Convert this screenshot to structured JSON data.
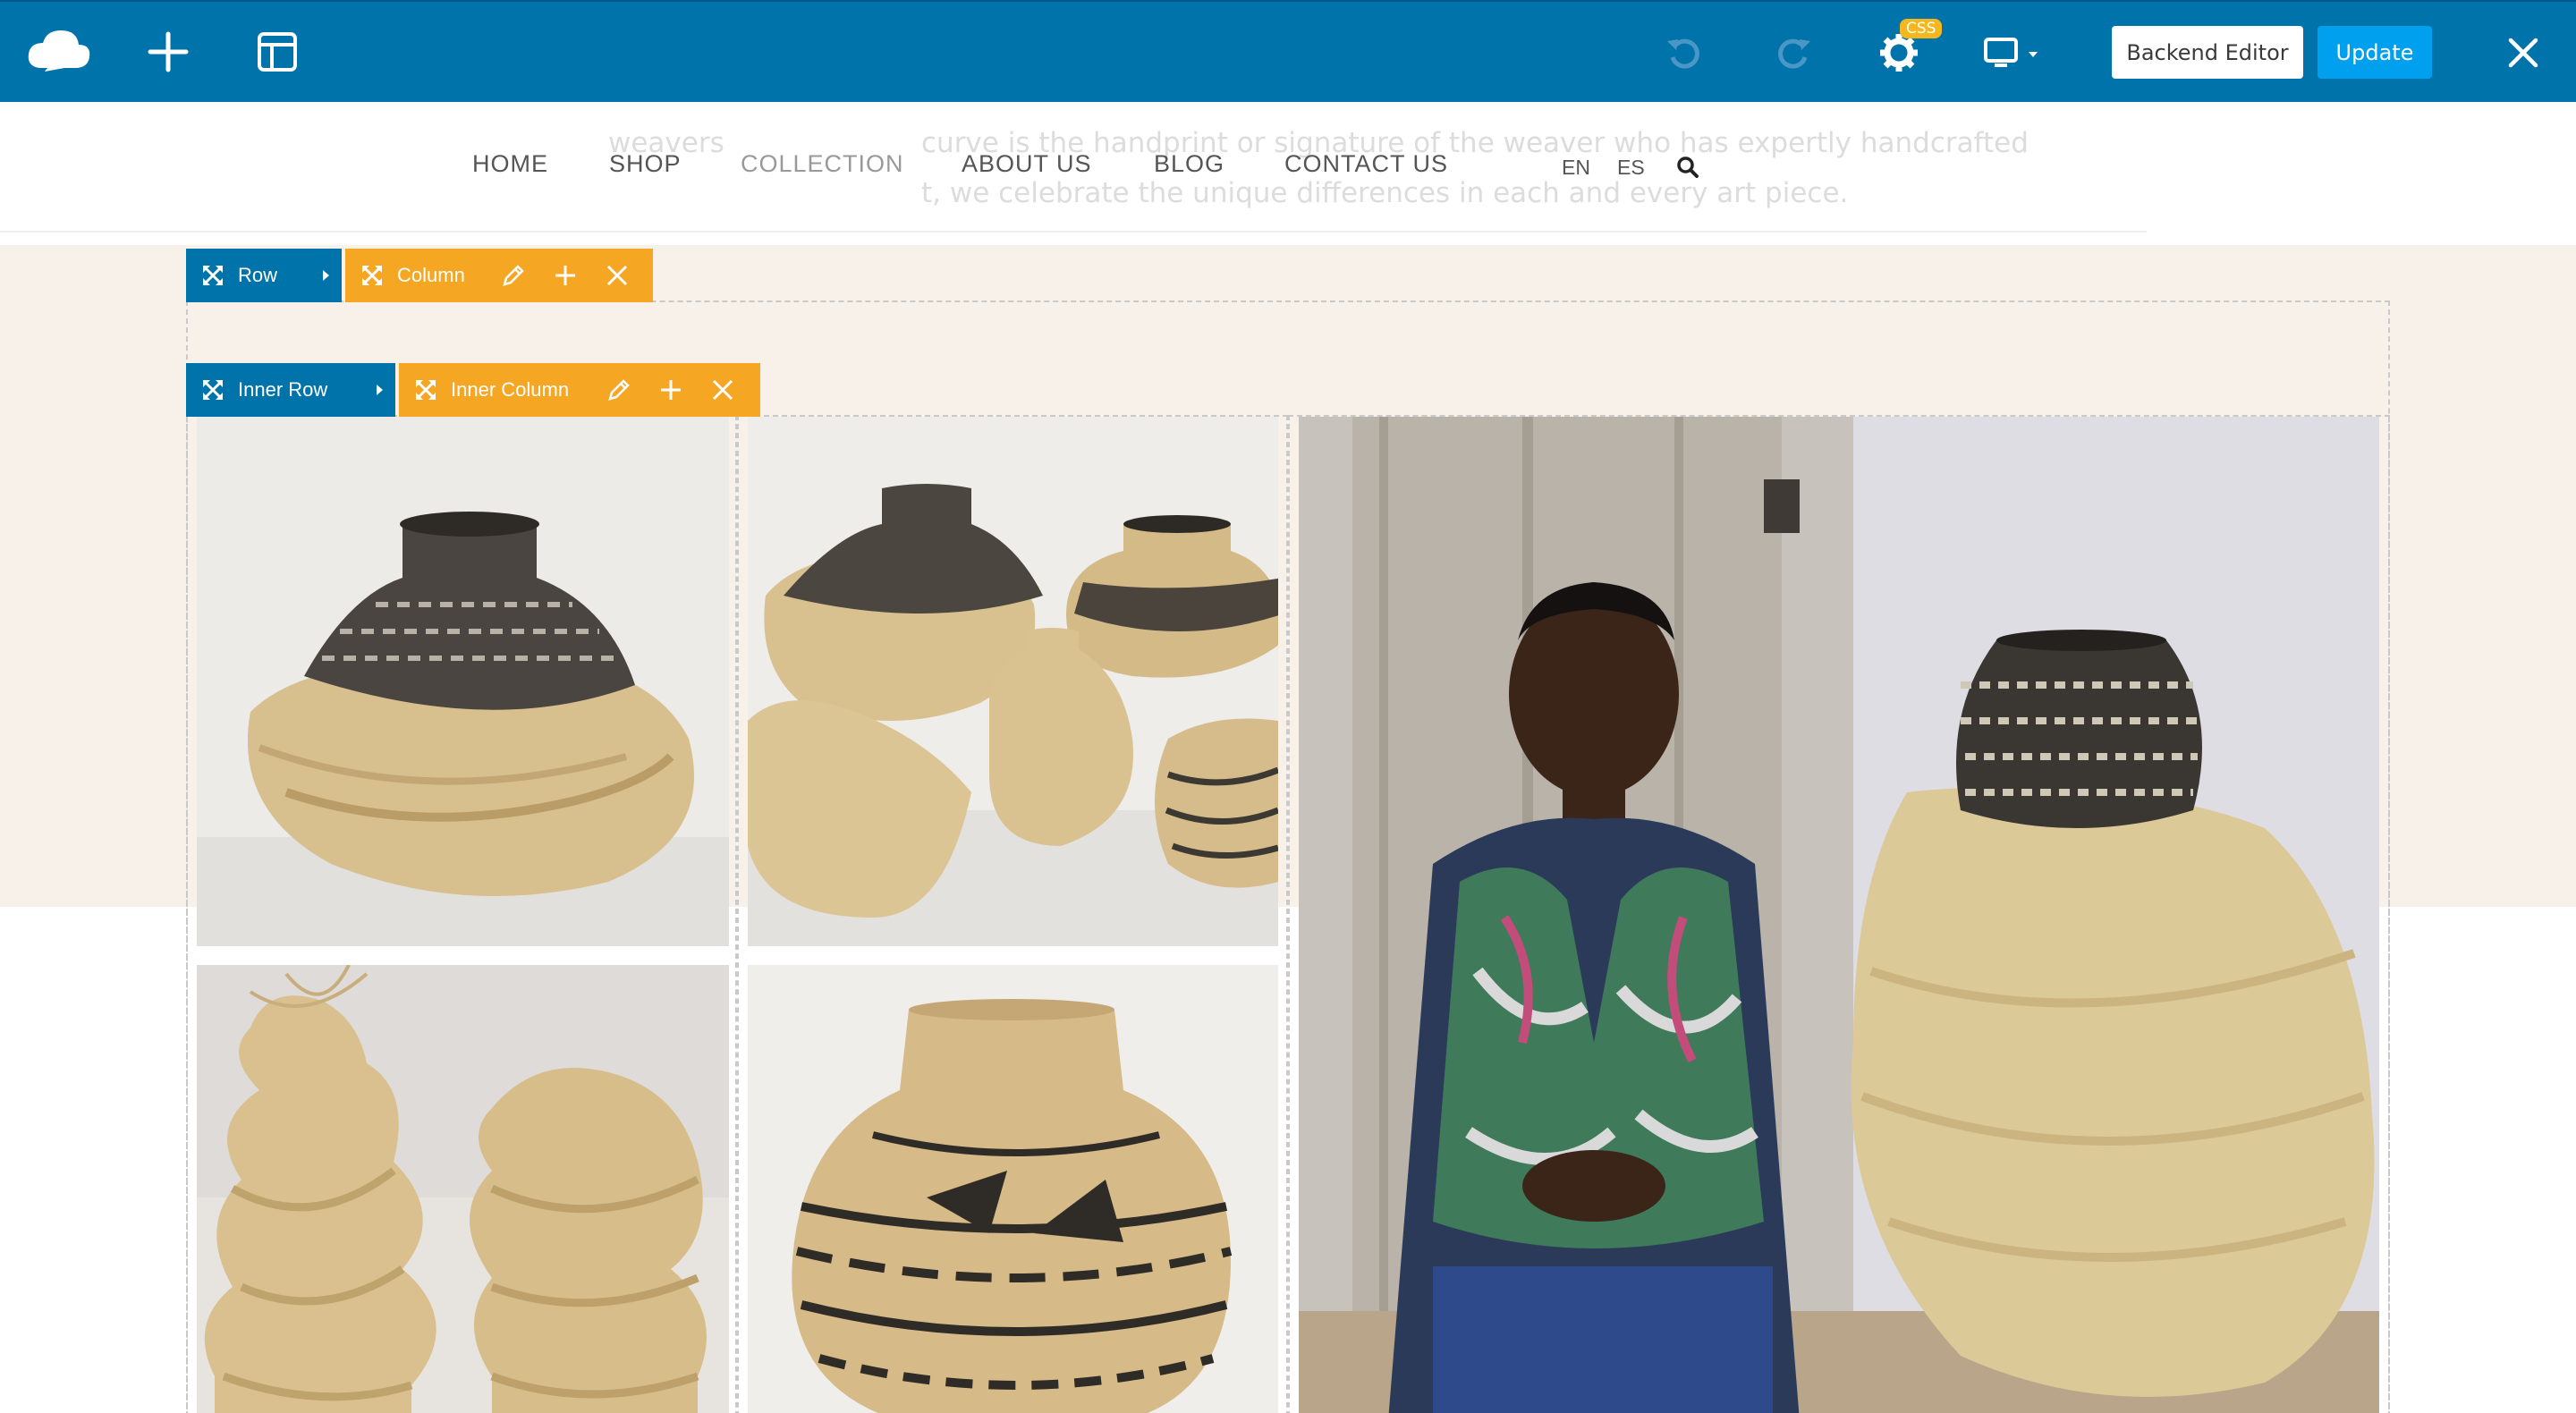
{
  "toolbar": {
    "logo_icon": "cloud-logo-icon",
    "add_icon": "plus-icon",
    "templates_icon": "layout-icon",
    "undo_icon": "undo-icon",
    "redo_icon": "redo-icon",
    "settings_icon": "gear-icon",
    "css_badge": "CSS",
    "device_icon": "desktop-icon",
    "backend_editor_label": "Backend Editor",
    "update_label": "Update",
    "close_icon": "close-icon",
    "colors": {
      "bar": "#0073aa",
      "update": "#00a0ee",
      "badge": "#f4b71e"
    }
  },
  "header": {
    "ghost_line_1a": "weavers",
    "ghost_line_1b": "curve is the handprint or signature of the weaver who has expertly handcrafted",
    "ghost_line_2": "t, we celebrate the unique differences in each and every art piece.",
    "nav": [
      {
        "label": "HOME"
      },
      {
        "label": "SHOP"
      },
      {
        "label": "COLLECTION"
      },
      {
        "label": "ABOUT US"
      },
      {
        "label": "BLOG"
      },
      {
        "label": "CONTACT US"
      }
    ],
    "languages": [
      "EN",
      "ES"
    ],
    "search_icon": "search-icon"
  },
  "editor_controls": {
    "row": {
      "label": "Row",
      "icon": "move-icon"
    },
    "column": {
      "label": "Column",
      "icon": "move-icon"
    },
    "inner_row": {
      "label": "Inner Row",
      "icon": "move-icon"
    },
    "inner_column": {
      "label": "Inner Column",
      "icon": "move-icon"
    },
    "action_icons": [
      "pencil-icon",
      "plus-icon",
      "close-icon"
    ],
    "colors": {
      "row": "#0073aa",
      "column": "#f5a623"
    }
  },
  "gallery": {
    "images": [
      {
        "name": "twisted-basket-photo"
      },
      {
        "name": "basket-group-photo"
      },
      {
        "name": "stacked-baskets-photo"
      },
      {
        "name": "striped-basket-photo"
      },
      {
        "name": "weaver-with-basket-photo"
      }
    ]
  }
}
